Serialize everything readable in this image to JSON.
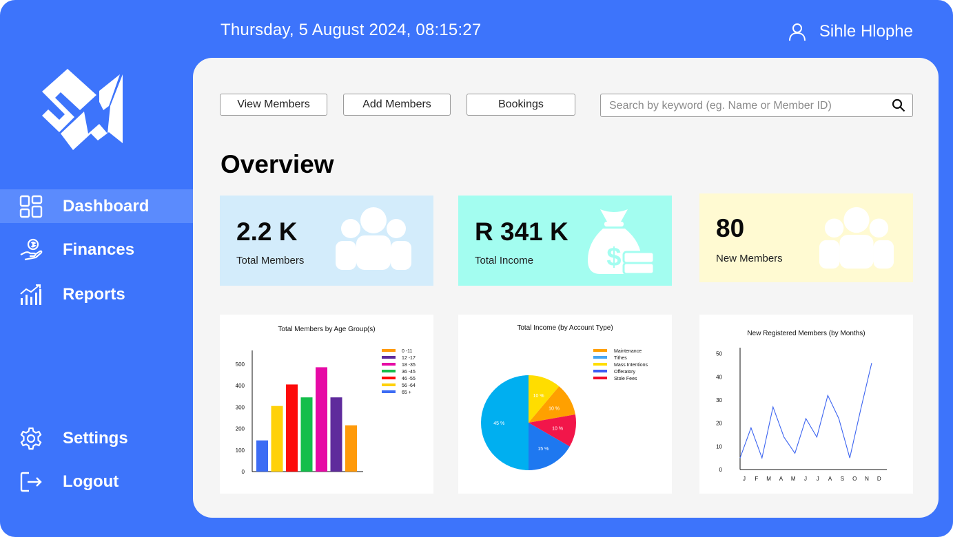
{
  "header": {
    "datetime": "Thursday, 5 August 2024, 08:15:27",
    "user_name": "Sihle Hlophe",
    "user_icon": "user-icon"
  },
  "sidebar": {
    "items": [
      {
        "label": "Dashboard",
        "icon": "dashboard-grid-icon",
        "active": true
      },
      {
        "label": "Finances",
        "icon": "hand-coin-icon"
      },
      {
        "label": "Reports",
        "icon": "bar-chart-trend-icon"
      }
    ],
    "bottom_items": [
      {
        "label": "Settings",
        "icon": "gear-icon"
      },
      {
        "label": "Logout",
        "icon": "logout-icon"
      }
    ]
  },
  "toolbar": {
    "view_members": "View Members",
    "add_members": "Add Members",
    "bookings": "Bookings",
    "search_placeholder": "Search by keyword (eg. Name or Member ID)"
  },
  "overview": {
    "title": "Overview",
    "cards": [
      {
        "value": "2.2 K",
        "label": "Total Members",
        "color": "#d3ecfb",
        "icon": "group-icon"
      },
      {
        "value": "R 341 K",
        "label": "Total Income",
        "color": "#a3fdf0",
        "icon": "money-bag-icon"
      },
      {
        "value": "80",
        "label": "New Members",
        "color": "#fffad2",
        "icon": "group-icon"
      }
    ]
  },
  "colors": {
    "brand": "#3d74fb",
    "sidebar_active": "#5b8bfd",
    "panel": "#f5f5f5"
  },
  "chart_data": [
    {
      "type": "bar",
      "title": "Total Members by Age Group(s)",
      "categories": [
        "0 -11",
        "12 -17",
        "18 -35",
        "36 -45",
        "46 -55",
        "56 -64",
        "65 +"
      ],
      "values": [
        145,
        305,
        405,
        345,
        485,
        345,
        215
      ],
      "colors": [
        "#3c6cf4",
        "#ffd10a",
        "#fd0a0a",
        "#14be4b",
        "#e60aa5",
        "#5f2b9c",
        "#ff9a0a"
      ],
      "yticks": [
        0,
        100,
        200,
        300,
        400,
        500
      ],
      "ylim": [
        0,
        560
      ],
      "legend": [
        {
          "label": "0 -11",
          "color": "#ff9a0a"
        },
        {
          "label": "12 -17",
          "color": "#5f2b9c"
        },
        {
          "label": "18 -35",
          "color": "#e60aa5"
        },
        {
          "label": "36 -45",
          "color": "#14be4b"
        },
        {
          "label": "46 -55",
          "color": "#fd0a0a"
        },
        {
          "label": "56 -64",
          "color": "#ffd10a"
        },
        {
          "label": "65 +",
          "color": "#3c6cf4"
        }
      ],
      "legend_position": "top-right"
    },
    {
      "type": "pie",
      "title": "Total Income (by Account Type)",
      "slices": [
        {
          "value": 10,
          "label": "10 %",
          "color": "#ffdd00"
        },
        {
          "value": 10,
          "label": "10 %",
          "color": "#ffa000"
        },
        {
          "value": 10,
          "label": "10 %",
          "color": "#f2164a"
        },
        {
          "value": 15,
          "label": "15 %",
          "color": "#1e78f0"
        },
        {
          "value": 45,
          "label": "45 %",
          "color": "#00aff0"
        }
      ],
      "legend": [
        {
          "label": "Maintenance",
          "color": "#ffa000"
        },
        {
          "label": "Tithes",
          "color": "#47a6f3"
        },
        {
          "label": "Mass Intentions",
          "color": "#ffdd00"
        },
        {
          "label": "Offeratory",
          "color": "#3c5cf4"
        },
        {
          "label": "Stole Fees",
          "color": "#f00b2a"
        }
      ],
      "legend_position": "top-right"
    },
    {
      "type": "line",
      "title": "New Registered Members (by Months)",
      "x": [
        "J",
        "F",
        "M",
        "A",
        "M",
        "J",
        "J",
        "A",
        "S",
        "O",
        "N",
        "D"
      ],
      "y": [
        5,
        18,
        5,
        27,
        14,
        7,
        22,
        14,
        32,
        22,
        5,
        26,
        46
      ],
      "yticks": [
        0,
        10,
        20,
        30,
        40,
        50
      ],
      "ylim": [
        0,
        52
      ],
      "grid": false,
      "line_color": "#3c64f0"
    }
  ]
}
